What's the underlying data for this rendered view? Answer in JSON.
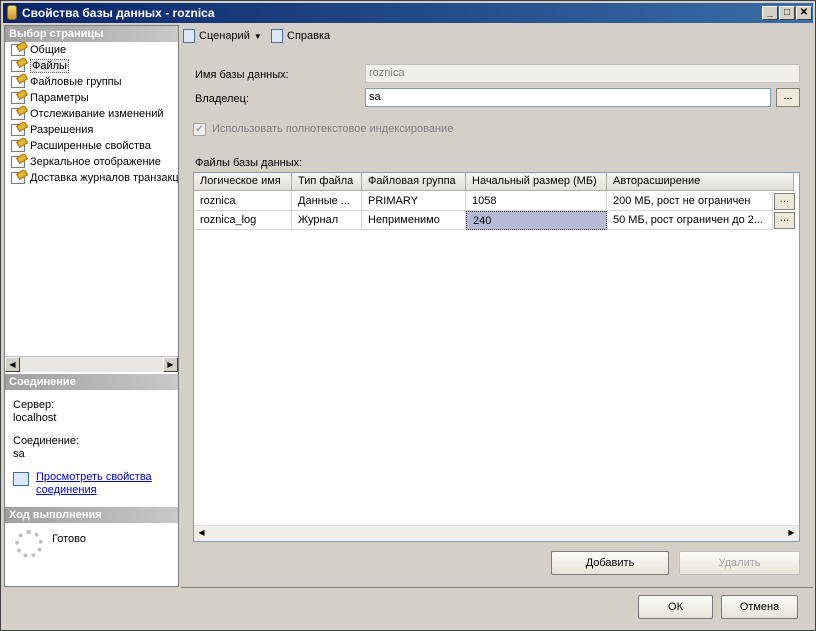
{
  "window": {
    "title": "Свойства базы данных - roznica"
  },
  "select_page": {
    "header": "Выбор страницы",
    "items": [
      {
        "label": "Общие"
      },
      {
        "label": "Файлы",
        "selected": true
      },
      {
        "label": "Файловые группы"
      },
      {
        "label": "Параметры"
      },
      {
        "label": "Отслеживание изменений"
      },
      {
        "label": "Разрешения"
      },
      {
        "label": "Расширенные свойства"
      },
      {
        "label": "Зеркальное отображение"
      },
      {
        "label": "Доставка журналов транзакций"
      }
    ]
  },
  "connection": {
    "header": "Соединение",
    "server_label": "Сервер:",
    "server_value": "localhost",
    "connection_label": "Соединение:",
    "connection_value": "sa",
    "view_props_link_line1": "Просмотреть свойства",
    "view_props_link_line2": "соединения"
  },
  "progress": {
    "header": "Ход выполнения",
    "status": "Готово"
  },
  "toolbar": {
    "script_label": "Сценарий",
    "help_label": "Справка"
  },
  "form": {
    "db_name_label": "Имя базы данных:",
    "db_name_value": "roznica",
    "owner_label": "Владелец:",
    "owner_value": "sa",
    "browse_label": "...",
    "fulltext_label": "Использовать полнотекстовое индексирование",
    "fulltext_checked": true,
    "files_label": "Файлы базы данных:"
  },
  "files_table": {
    "columns": [
      "Логическое имя",
      "Тип файла",
      "Файловая группа",
      "Начальный размер (МБ)",
      "Авторасширение"
    ],
    "rows": [
      [
        "roznica",
        "Данные ...",
        "PRIMARY",
        "1058",
        "200 МБ, рост не ограничен"
      ],
      [
        "roznica_log",
        "Журнал",
        "Неприменимо",
        "240",
        "50 МБ, рост ограничен до 2..."
      ]
    ],
    "cell_button": "..."
  },
  "buttons": {
    "add": "Добавить",
    "remove": "Удалить",
    "ok": "ОК",
    "cancel": "Отмена"
  },
  "colors": {
    "title_bar": "#0a246a",
    "section_header": "#a0a0a0",
    "selected_cell": "#b6bcd8",
    "dialog_bg": "#d4d0c8"
  }
}
